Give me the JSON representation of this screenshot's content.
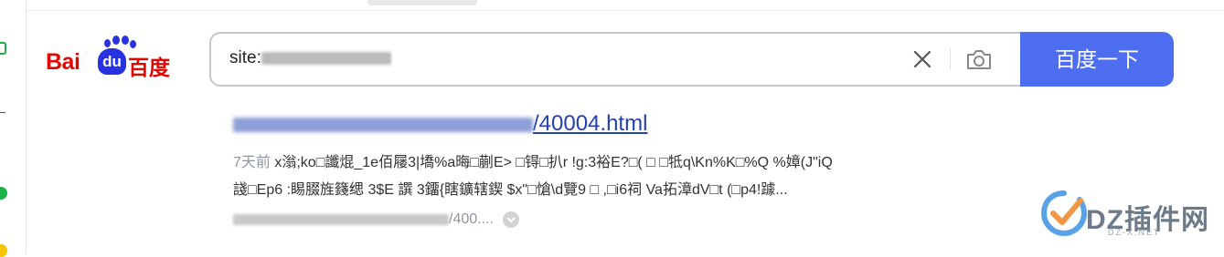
{
  "search": {
    "query_prefix": "site:",
    "search_button_label": "百度一下"
  },
  "logo": {
    "latin_part1": "Bai",
    "du_badge": "du",
    "chinese": "百度"
  },
  "result": {
    "title_suffix": "/40004.html",
    "time": "7天前",
    "snippet_line1": "x滃;ko□讖焜_1e佰屦3|墧%a晦□蒯E> □锝□扒r !g:3裕E?□( □ □牴q\\Kn%K□%Q %嫜(J\"iQ",
    "snippet_line2": "諓□Ep6 :睗腏旌籛缌 3$E 譔 3鐂{瞎鑛辖鍥 $x\"□愴\\d覽9 □ ,□i6祠 Va拓漳dV□t (□p4!躆...",
    "url_suffix": "/400...."
  },
  "watermark": {
    "text": "DZ插件网",
    "sub": "DZ-X.NET"
  },
  "colors": {
    "brand_red": "#e10602",
    "brand_blue": "#2932e1",
    "button_blue": "#4e6ef2",
    "link_blue": "#2440b3"
  },
  "icons": [
    "clear-icon",
    "camera-icon",
    "paw-icon",
    "dropdown-arrow-icon",
    "watermark-logo-icon"
  ]
}
